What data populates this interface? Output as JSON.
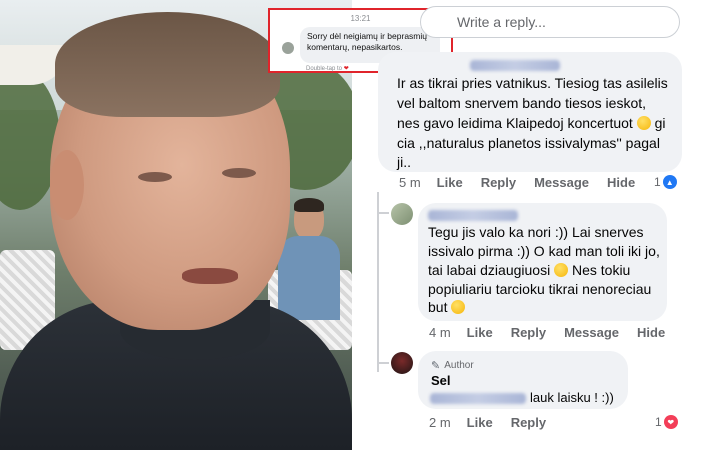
{
  "notification": {
    "time": "13:21",
    "message_line1": "Sorry dėl neigiamų ir beprasmių",
    "message_line2": "komentarų, nepasikartos.",
    "hint": "Double-tap to",
    "heart_icon": "heart-icon"
  },
  "reply_box": {
    "placeholder": "Write a reply..."
  },
  "comments": [
    {
      "text_lines": [
        "Ir as tikrai pries vatnikus. Tiesiog tas asilelis",
        "vel baltom snervem bando tiesos ieskot,",
        "nes gavo leidima Klaipedoj koncertuot",
        "gi",
        "cia ,,naturalus planetos issivalymas'' pagal",
        "ji.."
      ],
      "time": "5 m",
      "actions": [
        "Like",
        "Reply",
        "Message",
        "Hide"
      ],
      "reaction_count": "1",
      "reaction_icon": "like-icon"
    },
    {
      "text_lines": [
        "Tegu jis valo ka nori :)) Lai snerves",
        "issivalo pirma :)) O kad man toli iki jo,",
        "tai labai dziaugiuosi",
        "Nes tokiu",
        "popiuliariu tarcioku tikrai nenoreciau",
        "but"
      ],
      "time": "4 m",
      "actions": [
        "Like",
        "Reply",
        "Message",
        "Hide"
      ]
    },
    {
      "badge": "Author",
      "name": "Sel",
      "text_suffix": "lauk laisku ! :))",
      "time": "2 m",
      "actions": [
        "Like",
        "Reply"
      ],
      "reaction_count": "1",
      "reaction_icon": "love-icon"
    }
  ],
  "colors": {
    "highlight_border": "#e0242b",
    "bubble_bg": "#f0f2f5",
    "meta_text": "#65676b",
    "like_blue": "#2078f4",
    "love_red": "#f33e58"
  }
}
